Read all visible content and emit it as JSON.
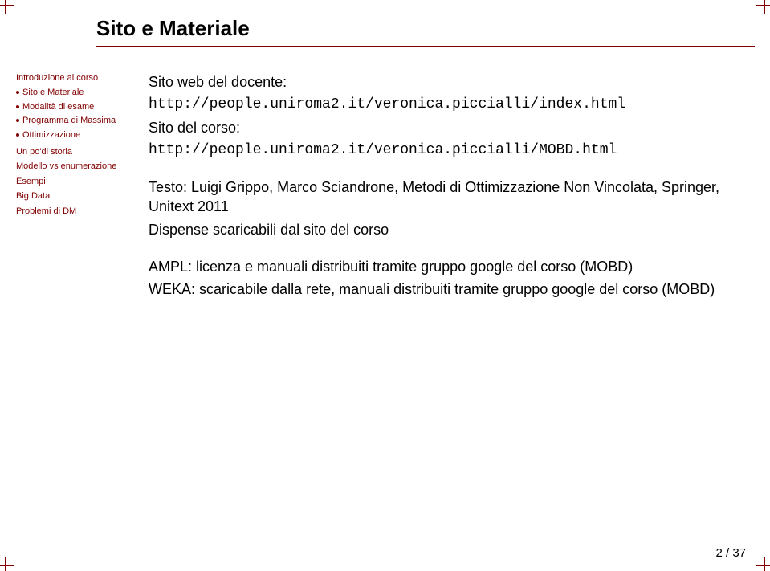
{
  "title": "Sito e Materiale",
  "sidebar": {
    "items": [
      {
        "label": "Introduzione al corso",
        "type": "item"
      },
      {
        "label": "Sito e Materiale",
        "type": "sub"
      },
      {
        "label": "Modalità di esame",
        "type": "sub"
      },
      {
        "label": "Programma di Massima",
        "type": "sub"
      },
      {
        "label": "Ottimizzazione",
        "type": "sub"
      },
      {
        "label": "Un po'di storia",
        "type": "item"
      },
      {
        "label": "Modello vs enumerazione",
        "type": "item"
      },
      {
        "label": "Esempi",
        "type": "item"
      },
      {
        "label": "Big Data",
        "type": "item"
      },
      {
        "label": "Problemi di DM",
        "type": "item"
      }
    ]
  },
  "content": {
    "site_label": "Sito web del docente:",
    "site_url": "http://people.uniroma2.it/veronica.piccialli/index.html",
    "course_label": "Sito del corso:",
    "course_url": "http://people.uniroma2.it/veronica.piccialli/MOBD.html",
    "text_line1": "Testo: Luigi Grippo, Marco Sciandrone, Metodi di Ottimizzazione Non Vincolata, Springer, Unitext 2011",
    "text_line2": "Dispense scaricabili dal sito del corso",
    "ampl": "AMPL: licenza e manuali distribuiti tramite gruppo google del corso (MOBD)",
    "weka": "WEKA: scaricabile dalla rete, manuali distribuiti tramite gruppo google del corso (MOBD)"
  },
  "footer": {
    "page": "2 / 37"
  }
}
